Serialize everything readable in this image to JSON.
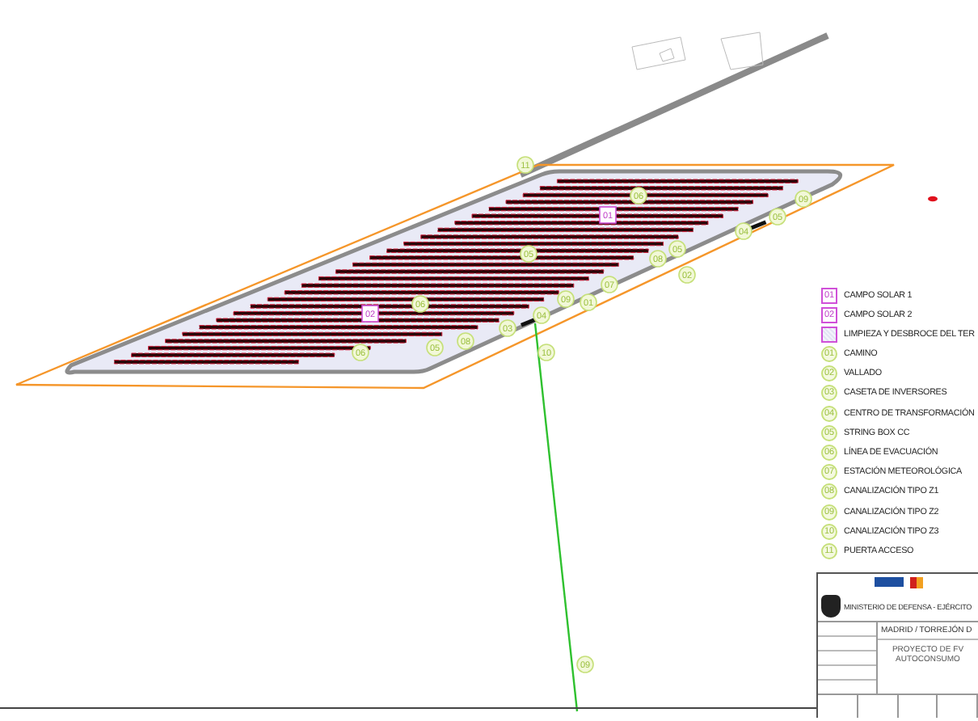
{
  "plan_markers": [
    {
      "label": "11",
      "kind": "circle"
    },
    {
      "label": "06",
      "kind": "circle"
    },
    {
      "label": "09",
      "kind": "circle"
    },
    {
      "label": "01",
      "kind": "square"
    },
    {
      "label": "05",
      "kind": "circle"
    },
    {
      "label": "04",
      "kind": "circle"
    },
    {
      "label": "05",
      "kind": "circle"
    },
    {
      "label": "08",
      "kind": "circle"
    },
    {
      "label": "05",
      "kind": "circle"
    },
    {
      "label": "02",
      "kind": "circle"
    },
    {
      "label": "07",
      "kind": "circle"
    },
    {
      "label": "09",
      "kind": "circle"
    },
    {
      "label": "01",
      "kind": "circle"
    },
    {
      "label": "04",
      "kind": "circle"
    },
    {
      "label": "03",
      "kind": "circle"
    },
    {
      "label": "10",
      "kind": "circle"
    },
    {
      "label": "06",
      "kind": "circle"
    },
    {
      "label": "02",
      "kind": "square"
    },
    {
      "label": "08",
      "kind": "circle"
    },
    {
      "label": "05",
      "kind": "circle"
    },
    {
      "label": "06",
      "kind": "circle"
    },
    {
      "label": "09",
      "kind": "circle"
    }
  ],
  "legend": [
    {
      "kind": "square",
      "code": "01",
      "label": "CAMPO SOLAR 1"
    },
    {
      "kind": "square",
      "code": "02",
      "label": "CAMPO SOLAR 2"
    },
    {
      "kind": "hatch",
      "label": "LIMPIEZA Y DESBROCE DEL TER"
    },
    {
      "kind": "circle",
      "code": "01",
      "label": "CAMINO"
    },
    {
      "kind": "circle",
      "code": "02",
      "label": "VALLADO"
    },
    {
      "kind": "circle",
      "code": "03",
      "label": "CASETA DE INVERSORES"
    },
    {
      "kind": "circle",
      "code": "04",
      "label": "CENTRO DE TRANSFORMACIÓN"
    },
    {
      "kind": "circle",
      "code": "05",
      "label": "STRING BOX CC"
    },
    {
      "kind": "circle",
      "code": "06",
      "label": "LÍNEA DE EVACUACIÓN"
    },
    {
      "kind": "circle",
      "code": "07",
      "label": "ESTACIÓN METEOROLÓGICA"
    },
    {
      "kind": "circle",
      "code": "08",
      "label": "CANALIZACIÓN TIPO Z1"
    },
    {
      "kind": "circle",
      "code": "09",
      "label": "CANALIZACIÓN TIPO Z2"
    },
    {
      "kind": "circle",
      "code": "10",
      "label": "CANALIZACIÓN TIPO Z3"
    },
    {
      "kind": "circle",
      "code": "11",
      "label": "PUERTA ACCESO"
    }
  ],
  "title_block": {
    "header": [
      "MINISTERIO DE DEFENSA - EJÉRCITO"
    ],
    "location": "MADRID / TORREJÓN D",
    "project": [
      "PROYECTO DE FV",
      "AUTOCONSUMO"
    ]
  }
}
